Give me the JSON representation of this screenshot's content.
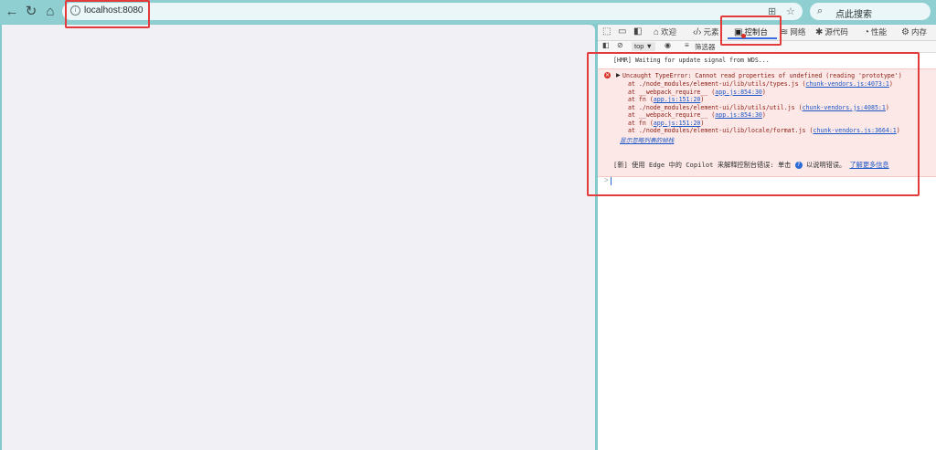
{
  "browser": {
    "url": "localhost:8080",
    "search_placeholder": "点此搜索"
  },
  "devtools": {
    "tabs": [
      {
        "label": "欢迎"
      },
      {
        "label": "元素"
      },
      {
        "label": "控制台"
      },
      {
        "label": "网络"
      },
      {
        "label": "源代码"
      },
      {
        "label": "性能"
      },
      {
        "label": "内存"
      }
    ],
    "context": "top ▼",
    "filter_label": "筛选器"
  },
  "console": {
    "hmr": "[HMR] Waiting for update signal from WDS...",
    "error": {
      "title": "Uncaught TypeError: Cannot read properties of undefined (reading 'prototype')",
      "stack": [
        {
          "text": "at ./node_modules/element-ui/lib/utils/types.js (",
          "link": "chunk-vendors.js:4073:1",
          "tail": ")"
        },
        {
          "text": "at __webpack_require__ (",
          "link": "app.js:854:30",
          "tail": ")"
        },
        {
          "text": "at fn (",
          "link": "app.js:151:20",
          "tail": ")"
        },
        {
          "text": "at ./node_modules/element-ui/lib/utils/util.js (",
          "link": "chunk-vendors.js:4085:1",
          "tail": ")"
        },
        {
          "text": "at __webpack_require__ (",
          "link": "app.js:854:30",
          "tail": ")"
        },
        {
          "text": "at fn (",
          "link": "app.js:151:20",
          "tail": ")"
        },
        {
          "text": "at ./node_modules/element-ui/lib/locale/format.js (",
          "link": "chunk-vendors.js:3664:1",
          "tail": ")"
        }
      ],
      "show_ignored": "显示忽略列表的帧栈"
    },
    "copilot_prefix": "[新] 使用 Edge 中的 Copilot 来解释控制台错误: 单击",
    "copilot_middle": "以说明错误。",
    "copilot_link": "了解更多信息",
    "prompt": ">"
  }
}
